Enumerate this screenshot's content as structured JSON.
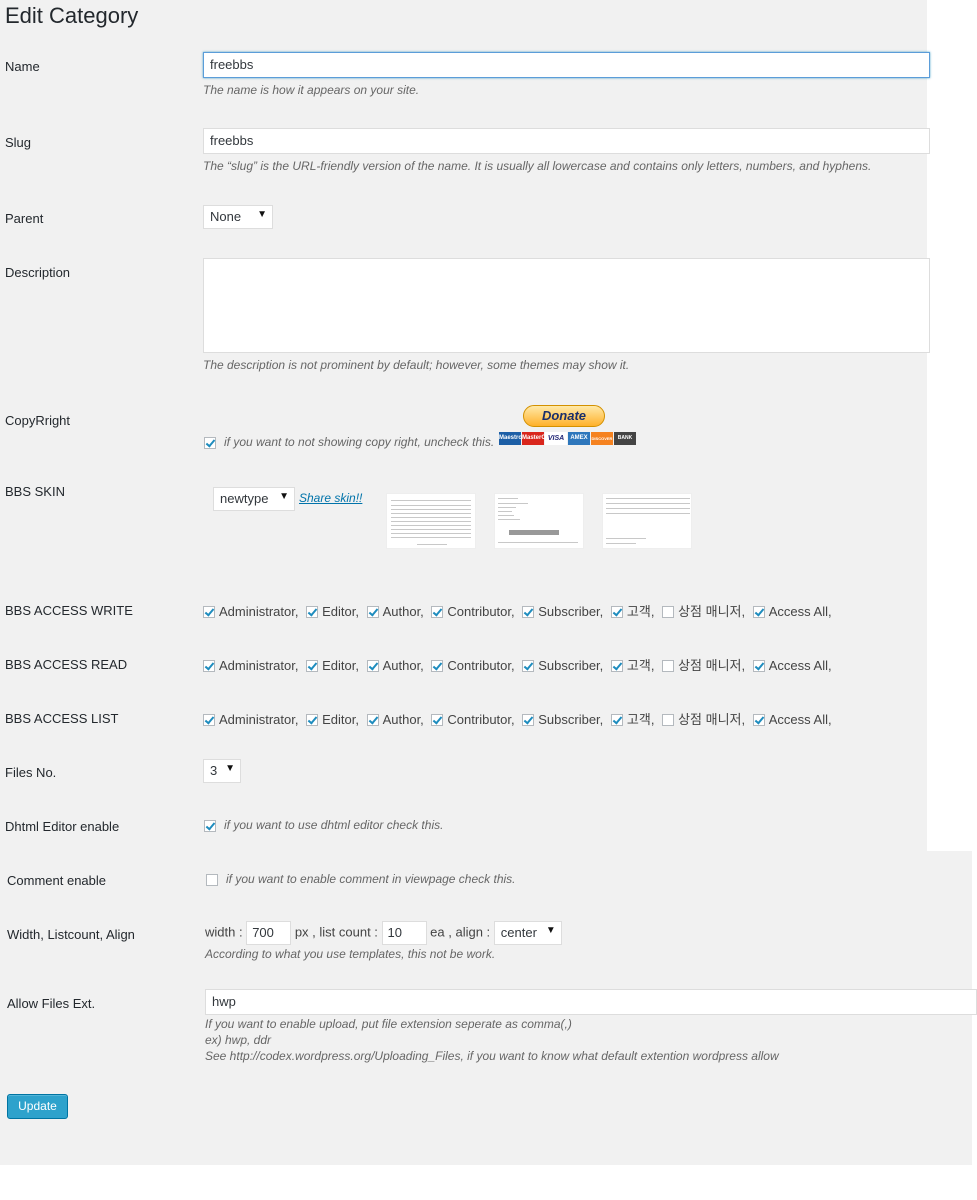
{
  "page": {
    "title": "Edit Category"
  },
  "name": {
    "label": "Name",
    "value": "freebbs",
    "hint": "The name is how it appears on your site."
  },
  "slug": {
    "label": "Slug",
    "value": "freebbs",
    "hint": "The “slug” is the URL-friendly version of the name. It is usually all lowercase and contains only letters, numbers, and hyphens."
  },
  "parent": {
    "label": "Parent",
    "selected": "None"
  },
  "description": {
    "label": "Description",
    "value": "",
    "hint": "The description is not prominent by default; however, some themes may show it."
  },
  "copyright": {
    "label": "CopyRright",
    "checked": true,
    "hint": "if you want to not showing copy right, uncheck this.",
    "donate_label": "Donate",
    "cards": [
      "Maestro",
      "MasterCard",
      "VISA",
      "AMEX",
      "DISCOVER",
      "BANK"
    ]
  },
  "skin": {
    "label": "BBS SKIN",
    "selected": "newtype",
    "share_link": "Share skin!!"
  },
  "access": {
    "write_label": "BBS ACCESS WRITE",
    "read_label": "BBS ACCESS READ",
    "list_label": "BBS ACCESS LIST",
    "roles": [
      "Administrator,",
      "Editor,",
      "Author,",
      "Contributor,",
      "Subscriber,",
      "고객,",
      "상점 매니저,",
      "Access All,"
    ],
    "checked": [
      true,
      true,
      true,
      true,
      true,
      true,
      false,
      true
    ]
  },
  "files_no": {
    "label": "Files No.",
    "selected": "3"
  },
  "dhtml": {
    "label": "Dhtml Editor enable",
    "checked": true,
    "hint": "if you want to use dhtml editor check this."
  },
  "comment": {
    "label": "Comment enable",
    "checked": false,
    "hint": "if you want to enable comment in viewpage check this."
  },
  "layout": {
    "label": "Width, Listcount, Align",
    "width_prefix": "width :",
    "width_value": "700",
    "width_suffix": "px , list count :",
    "listcount_value": "10",
    "listcount_suffix": "ea , align :",
    "align_selected": "center",
    "hint": "According to what you use templates, this not be work."
  },
  "files_ext": {
    "label": "Allow Files Ext.",
    "value": "hwp",
    "hint1": "If you want to enable upload, put file extension seperate as comma(,)",
    "hint2": "ex) hwp, ddr",
    "hint3": "See http://codex.wordpress.org/Uploading_Files, if you want to know what default extention wordpress allow"
  },
  "update_button": "Update"
}
